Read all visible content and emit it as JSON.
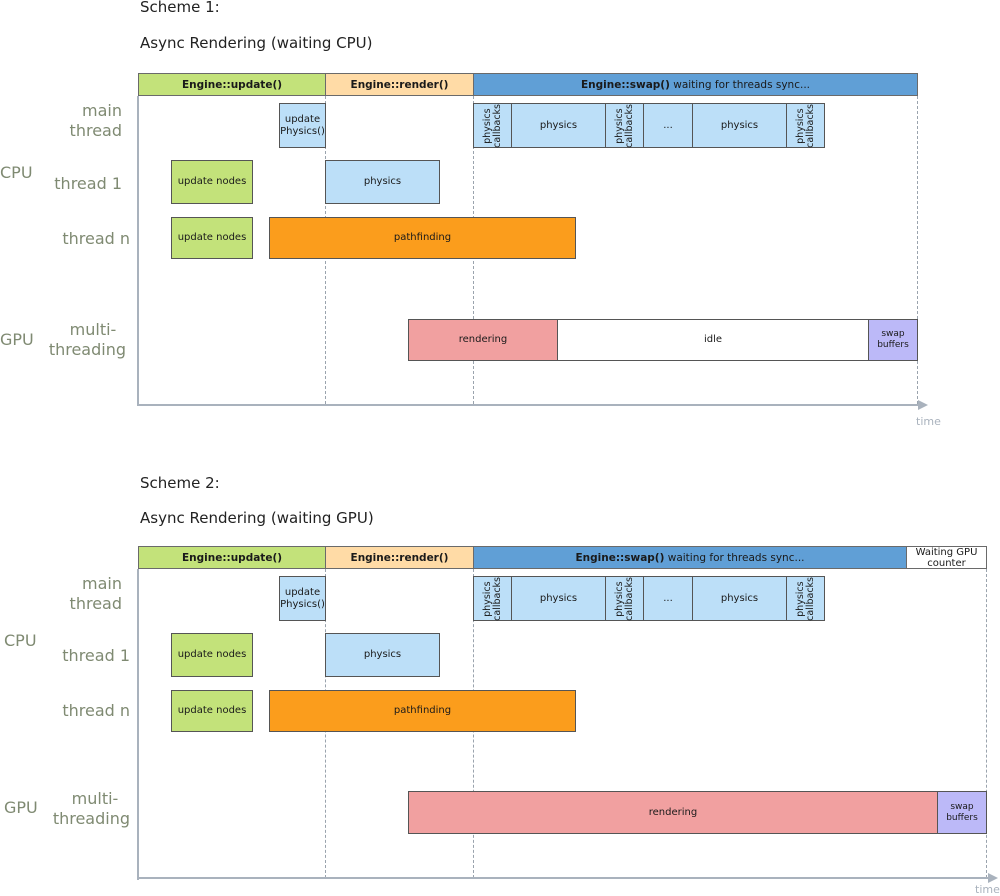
{
  "schemes": [
    {
      "heading": "Scheme 1:",
      "title": "Async Rendering (waiting CPU)",
      "phases": {
        "update": {
          "bold": "Engine::update()",
          "rest": ""
        },
        "render": {
          "bold": "Engine::render()",
          "rest": ""
        },
        "swap": {
          "bold": "Engine::swap()",
          "rest": " waiting for threads sync..."
        }
      },
      "labels": {
        "main_thread": [
          "main",
          "thread"
        ],
        "cpu": "CPU",
        "thread1": "thread 1",
        "threadn": "thread n",
        "gpu": "GPU",
        "multithreading": [
          "multi-",
          "threading"
        ]
      },
      "main_thread_tasks": {
        "update_physics": [
          "update",
          "Physics()"
        ],
        "callbacks": [
          "physics",
          "callbacks"
        ],
        "physics": "physics",
        "ellipsis": "..."
      },
      "thread1_tasks": [
        "update nodes",
        "physics"
      ],
      "threadn_tasks": [
        "update nodes",
        "pathfinding"
      ],
      "gpu_tasks": {
        "rendering": "rendering",
        "idle": "idle",
        "swap": [
          "swap",
          "buffers"
        ]
      },
      "axis_label": "time"
    },
    {
      "heading": "Scheme 2:",
      "title": "Async Rendering (waiting GPU)",
      "phases": {
        "update": {
          "bold": "Engine::update()",
          "rest": ""
        },
        "render": {
          "bold": "Engine::render()",
          "rest": ""
        },
        "swap": {
          "bold": "Engine::swap()",
          "rest": " waiting for threads sync..."
        },
        "waiting": [
          "Waiting GPU",
          "counter"
        ]
      },
      "labels": {
        "main_thread": [
          "main",
          "thread"
        ],
        "cpu": "CPU",
        "thread1": "thread 1",
        "threadn": "thread n",
        "gpu": "GPU",
        "multithreading": [
          "multi-",
          "threading"
        ]
      },
      "main_thread_tasks": {
        "update_physics": [
          "update",
          "Physics()"
        ],
        "callbacks": [
          "physics",
          "callbacks"
        ],
        "physics": "physics",
        "ellipsis": "..."
      },
      "thread1_tasks": [
        "update nodes",
        "physics"
      ],
      "threadn_tasks": [
        "update nodes",
        "pathfinding"
      ],
      "gpu_tasks": {
        "rendering": "rendering",
        "swap": [
          "swap",
          "buffers"
        ]
      },
      "axis_label": "time"
    }
  ]
}
